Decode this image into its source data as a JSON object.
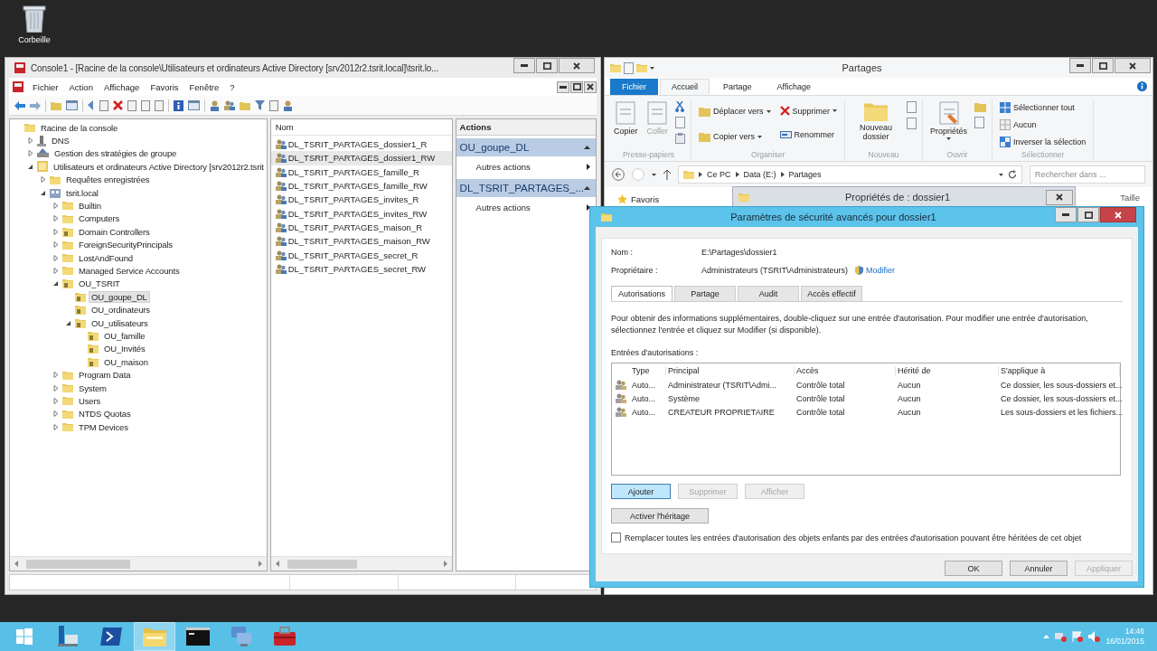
{
  "desktop": {
    "icons": [
      {
        "label": "Corbeille"
      }
    ]
  },
  "mmc": {
    "title": "Console1 - [Racine de la console\\Utilisateurs et ordinateurs Active Directory [srv2012r2.tsrit.local]\\tsrit.lo...",
    "menu": [
      "Fichier",
      "Action",
      "Affichage",
      "Favoris",
      "Fenêtre",
      "?"
    ],
    "tree": [
      {
        "label": "Racine de la console",
        "kind": "root",
        "selected": false,
        "children": [
          {
            "label": "DNS",
            "kind": "dns",
            "expanded": false,
            "selected": false
          },
          {
            "label": "Gestion des stratégies de groupe",
            "kind": "gpo",
            "expanded": false,
            "selected": false
          },
          {
            "label": "Utilisateurs et ordinateurs Active Directory [srv2012r2.tsrit",
            "kind": "ad",
            "expanded": true,
            "selected": false,
            "children": [
              {
                "label": "Requêtes enregistrées",
                "kind": "folder",
                "expanded": false,
                "selected": false
              },
              {
                "label": "tsrit.local",
                "kind": "domain",
                "expanded": true,
                "selected": false,
                "children": [
                  {
                    "label": "Builtin",
                    "kind": "folder",
                    "expanded": false,
                    "selected": false
                  },
                  {
                    "label": "Computers",
                    "kind": "folder",
                    "expanded": false,
                    "selected": false
                  },
                  {
                    "label": "Domain Controllers",
                    "kind": "ou",
                    "expanded": false,
                    "selected": false
                  },
                  {
                    "label": "ForeignSecurityPrincipals",
                    "kind": "folder",
                    "expanded": false,
                    "selected": false
                  },
                  {
                    "label": "LostAndFound",
                    "kind": "folder",
                    "expanded": false,
                    "selected": false
                  },
                  {
                    "label": "Managed Service Accounts",
                    "kind": "folder",
                    "expanded": false,
                    "selected": false
                  },
                  {
                    "label": "OU_TSRIT",
                    "kind": "ou",
                    "expanded": true,
                    "selected": false,
                    "children": [
                      {
                        "label": "OU_goupe_DL",
                        "kind": "ou",
                        "selected": true
                      },
                      {
                        "label": "OU_ordinateurs",
                        "kind": "ou",
                        "selected": false
                      },
                      {
                        "label": "OU_utilisateurs",
                        "kind": "ou",
                        "expanded": true,
                        "selected": false,
                        "children": [
                          {
                            "label": "OU_famille",
                            "kind": "ou",
                            "selected": false
                          },
                          {
                            "label": "OU_Invités",
                            "kind": "ou",
                            "selected": false
                          },
                          {
                            "label": "OU_maison",
                            "kind": "ou",
                            "selected": false
                          }
                        ]
                      }
                    ]
                  },
                  {
                    "label": "Program Data",
                    "kind": "folder",
                    "expanded": false,
                    "selected": false
                  },
                  {
                    "label": "System",
                    "kind": "folder",
                    "expanded": false,
                    "selected": false
                  },
                  {
                    "label": "Users",
                    "kind": "folder",
                    "expanded": false,
                    "selected": false
                  },
                  {
                    "label": "NTDS Quotas",
                    "kind": "folder",
                    "expanded": false,
                    "selected": false
                  },
                  {
                    "label": "TPM Devices",
                    "kind": "folder",
                    "expanded": false,
                    "selected": false
                  }
                ]
              }
            ]
          }
        ]
      }
    ],
    "list": {
      "columns": [
        "Nom"
      ],
      "rows": [
        {
          "name": "DL_TSRIT_PARTAGES_dossier1_R",
          "selected": false
        },
        {
          "name": "DL_TSRIT_PARTAGES_dossier1_RW",
          "selected": true
        },
        {
          "name": "DL_TSRIT_PARTAGES_famille_R",
          "selected": false
        },
        {
          "name": "DL_TSRIT_PARTAGES_famille_RW",
          "selected": false
        },
        {
          "name": "DL_TSRIT_PARTAGES_invites_R",
          "selected": false
        },
        {
          "name": "DL_TSRIT_PARTAGES_invites_RW",
          "selected": false
        },
        {
          "name": "DL_TSRIT_PARTAGES_maison_R",
          "selected": false
        },
        {
          "name": "DL_TSRIT_PARTAGES_maison_RW",
          "selected": false
        },
        {
          "name": "DL_TSRIT_PARTAGES_secret_R",
          "selected": false
        },
        {
          "name": "DL_TSRIT_PARTAGES_secret_RW",
          "selected": false
        }
      ]
    },
    "actions": {
      "title": "Actions",
      "sections": [
        {
          "title": "OU_goupe_DL",
          "items": [
            "Autres actions"
          ]
        },
        {
          "title": "DL_TSRIT_PARTAGES_...",
          "items": [
            "Autres actions"
          ]
        }
      ]
    }
  },
  "explorer": {
    "title": "Partages",
    "ribbon_tabs": [
      {
        "label": "Fichier",
        "kind": "file",
        "selected": false
      },
      {
        "label": "Accueil",
        "kind": "tab",
        "selected": true
      },
      {
        "label": "Partage",
        "kind": "tab",
        "selected": false
      },
      {
        "label": "Affichage",
        "kind": "tab",
        "selected": false
      }
    ],
    "ribbon_groups": [
      {
        "label": "Presse-papiers",
        "commands": [
          {
            "label": "Copier",
            "kind": "large",
            "disabled": false,
            "dropdown": false
          },
          {
            "label": "Coller",
            "kind": "large",
            "disabled": true,
            "dropdown": false
          }
        ]
      },
      {
        "label": "Organiser",
        "commands": [
          {
            "label": "Déplacer vers",
            "kind": "small",
            "disabled": false,
            "dropdown": true
          },
          {
            "label": "Copier vers",
            "kind": "small",
            "disabled": false,
            "dropdown": true
          },
          {
            "label": "Supprimer",
            "kind": "small",
            "disabled": false,
            "dropdown": true
          },
          {
            "label": "Renommer",
            "kind": "small",
            "disabled": false,
            "dropdown": false
          }
        ]
      },
      {
        "label": "Nouveau",
        "commands": [
          {
            "label": "Nouveau dossier",
            "kind": "large",
            "disabled": false,
            "dropdown": false
          }
        ]
      },
      {
        "label": "Ouvrir",
        "commands": [
          {
            "label": "Propriétés",
            "kind": "large",
            "disabled": false,
            "dropdown": true
          }
        ]
      },
      {
        "label": "Sélectionner",
        "commands": [
          {
            "label": "Sélectionner tout",
            "kind": "small",
            "disabled": false,
            "dropdown": false
          },
          {
            "label": "Aucun",
            "kind": "small",
            "disabled": false,
            "dropdown": false
          },
          {
            "label": "Inverser la sélection",
            "kind": "small",
            "disabled": false,
            "dropdown": false
          }
        ]
      }
    ],
    "path": [
      "Ce PC",
      "Data (E:)",
      "Partages"
    ],
    "search_placeholder": "Rechercher dans ...",
    "nav_items": [
      "Favoris"
    ],
    "columns": [
      "Taille"
    ]
  },
  "properties_dialog": {
    "title": "Propriétés de : dossier1"
  },
  "advanced": {
    "title": "Paramètres de sécurité avancés pour dossier1",
    "name_label": "Nom :",
    "name_value": "E:\\Partages\\dossier1",
    "owner_label": "Propriétaire :",
    "owner_value": "Administrateurs (TSRIT\\Administrateurs)",
    "change_link": "Modifier",
    "tabs": [
      {
        "label": "Autorisations",
        "selected": true
      },
      {
        "label": "Partage",
        "selected": false
      },
      {
        "label": "Audit",
        "selected": false
      },
      {
        "label": "Accès effectif",
        "selected": false
      }
    ],
    "info": "Pour obtenir des informations supplémentaires, double-cliquez sur une entrée d'autorisation. Pour modifier une entrée d'autorisation, sélectionnez l'entrée et cliquez sur Modifier (si disponible).",
    "entries_label": "Entrées d'autorisations :",
    "table": {
      "columns": [
        "Type",
        "Principal",
        "Accès",
        "Hérité de",
        "S'applique à"
      ],
      "rows": [
        {
          "cells": [
            "Auto...",
            "Administrateur (TSRIT\\Admi...",
            "Contrôle total",
            "Aucun",
            "Ce dossier, les sous-dossiers et..."
          ]
        },
        {
          "cells": [
            "Auto...",
            "Système",
            "Contrôle total",
            "Aucun",
            "Ce dossier, les sous-dossiers et..."
          ]
        },
        {
          "cells": [
            "Auto...",
            "CREATEUR PROPRIETAIRE",
            "Contrôle total",
            "Aucun",
            "Les sous-dossiers et les fichiers..."
          ]
        }
      ]
    },
    "buttons": [
      {
        "label": "Ajouter",
        "disabled": false,
        "focused": true
      },
      {
        "label": "Supprimer",
        "disabled": true,
        "focused": false
      },
      {
        "label": "Afficher",
        "disabled": true,
        "focused": false
      }
    ],
    "inheritance_button": "Activer l'héritage",
    "replace_checkbox": {
      "label": "Remplacer toutes les entrées d'autorisation des objets enfants par des entrées d'autorisation pouvant être héritées de cet objet",
      "checked": false
    },
    "footer_buttons": [
      {
        "label": "OK",
        "disabled": false
      },
      {
        "label": "Annuler",
        "disabled": false
      },
      {
        "label": "Appliquer",
        "disabled": true
      }
    ]
  },
  "taskbar": {
    "apps": [
      {
        "kind": "server",
        "active": false
      },
      {
        "kind": "shell",
        "active": false
      },
      {
        "kind": "explorer",
        "active": true
      },
      {
        "kind": "console",
        "active": false
      },
      {
        "kind": "network",
        "active": false
      },
      {
        "kind": "toolbox",
        "active": false
      }
    ],
    "time": "14:46",
    "date": "16/01/2015"
  }
}
